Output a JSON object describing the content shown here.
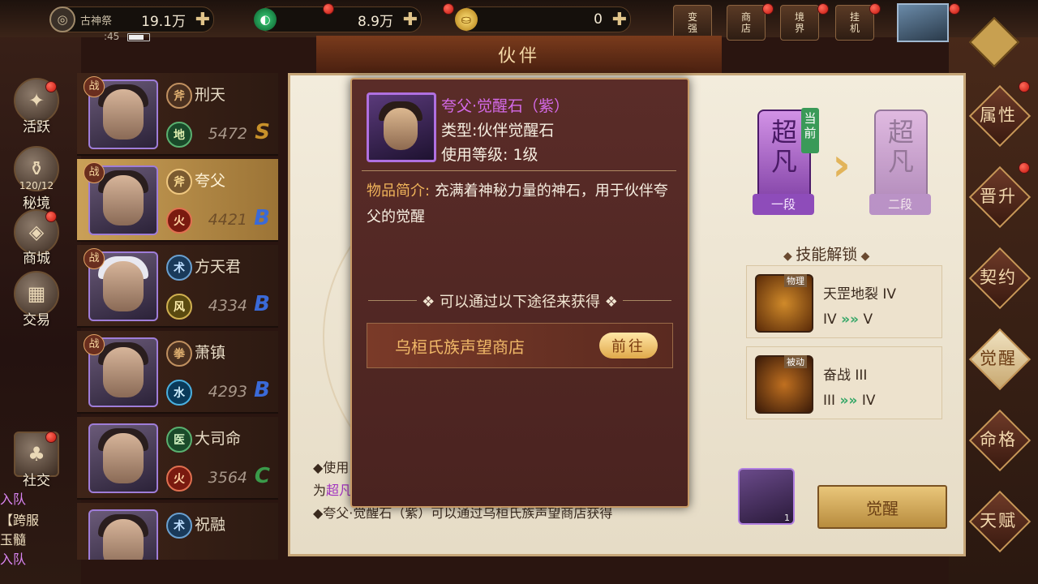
{
  "topbar": {
    "res1": {
      "label": "古神祭",
      "value": "19.1万",
      "sub": ":45"
    },
    "res2": {
      "value": "8.9万"
    },
    "res3": {
      "value": "0"
    },
    "icons": [
      {
        "name": "变强",
        "l1": "变",
        "l2": "强"
      },
      {
        "name": "商店",
        "l1": "商",
        "l2": "店"
      },
      {
        "name": "境界",
        "l1": "境",
        "l2": "界"
      },
      {
        "name": "挂机",
        "l1": "挂",
        "l2": "机"
      }
    ]
  },
  "title": "伙伴",
  "leftnav": {
    "items": [
      {
        "label": "活跃",
        "icon": "✦"
      },
      {
        "label": "秘境",
        "icon": "⚱",
        "count": "120/12"
      },
      {
        "label": "商城",
        "icon": "◈"
      },
      {
        "label": "交易",
        "icon": "▦"
      },
      {
        "label": "社交",
        "icon": "♣"
      }
    ],
    "chat": [
      "入队",
      "【跨服",
      "玉髓",
      "入队"
    ]
  },
  "partners": [
    {
      "class": "斧",
      "element": "地",
      "name": "刑天",
      "power": "5472",
      "grade": "S",
      "zhan": "战"
    },
    {
      "class": "斧",
      "element": "火",
      "name": "夸父",
      "power": "4421",
      "grade": "B",
      "zhan": "战"
    },
    {
      "class": "术",
      "element": "风",
      "name": "方天君",
      "power": "4334",
      "grade": "B",
      "zhan": "战"
    },
    {
      "class": "拳",
      "element": "水",
      "name": "萧镇",
      "power": "4293",
      "grade": "B",
      "zhan": "战"
    },
    {
      "class": "医",
      "element": "火",
      "name": "大司命",
      "power": "3564",
      "grade": "C"
    },
    {
      "class": "术",
      "element": "",
      "name": "祝融",
      "power": "",
      "grade": ""
    }
  ],
  "stages": {
    "current": {
      "c1": "超",
      "c2": "凡",
      "level": "一段",
      "tag": "当前"
    },
    "next": {
      "c1": "超",
      "c2": "凡",
      "level": "二段"
    }
  },
  "skills": {
    "title": "技能解锁",
    "items": [
      {
        "tag": "物理",
        "name": "天罡地裂 IV",
        "from": "IV",
        "to": "V"
      },
      {
        "tag": "被动",
        "name": "奋战 III",
        "from": "III",
        "to": "IV"
      }
    ]
  },
  "desc": {
    "line1": "◆使用",
    "line2a": "为",
    "line2b": "超凡",
    "line3": "◆夸父·觉醒石（紫）可以通过乌桓氏族声望商店获得"
  },
  "stone_slot": {
    "qty": "1"
  },
  "awaken_button": "觉醒",
  "right_tabs": [
    "属性",
    "晋升",
    "契约",
    "觉醒",
    "命格",
    "天赋"
  ],
  "tooltip": {
    "item_name": "夸父·觉醒石（紫）",
    "type_line": "类型:伙伴觉醒石",
    "level_line": "使用等级: 1级",
    "desc_key": "物品简介:",
    "desc_text": "充满着神秘力量的神石，用于伙伴夸父的觉醒",
    "obtain_title": "可以通过以下途径来获得",
    "source_name": "乌桓氏族声望商店",
    "go_button": "前往"
  },
  "colors": {
    "grade_S": "#c8912a",
    "grade_B": "#3a6ad8",
    "grade_C": "#3a9a4a",
    "purple": "#d46ae8"
  }
}
